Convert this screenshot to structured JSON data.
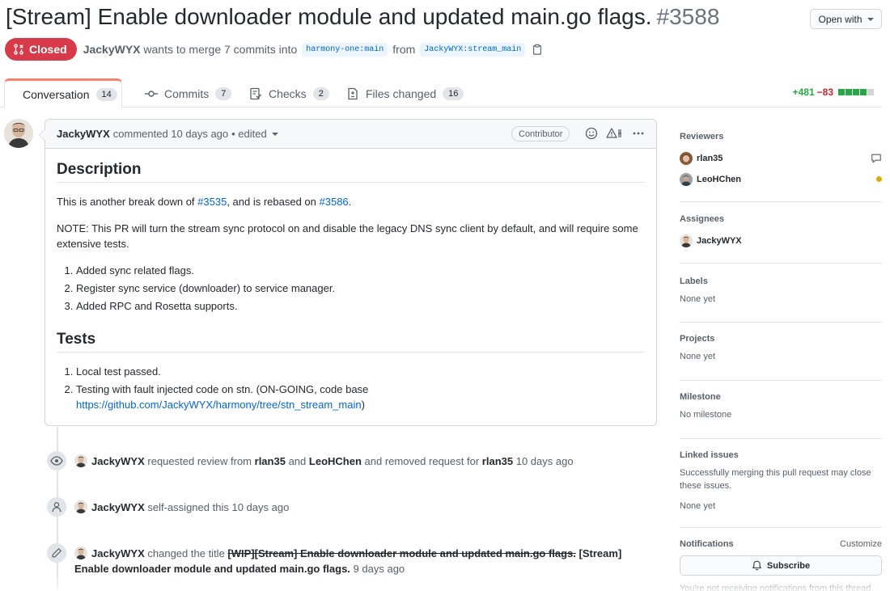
{
  "pr": {
    "title": "[Stream] Enable downloader module and updated main.go flags.",
    "number": "#3588",
    "open_with": "Open with",
    "state": "Closed",
    "author": "JackyWYX",
    "merge_text": "wants to merge 7 commits into",
    "base_branch": "harmony-one:main",
    "from_text": "from",
    "head_branch": "JackyWYX:stream_main"
  },
  "tabs": [
    {
      "label": "Conversation",
      "count": "14"
    },
    {
      "label": "Commits",
      "count": "7"
    },
    {
      "label": "Checks",
      "count": "2"
    },
    {
      "label": "Files changed",
      "count": "16"
    }
  ],
  "diffstat": {
    "additions": "+481",
    "deletions": "−83"
  },
  "comment": {
    "author": "JackyWYX",
    "action": "commented 10 days ago",
    "edited": "• edited",
    "role": "Contributor",
    "h_description": "Description",
    "p1_pre": "This is another break down of ",
    "p1_link1": "#3535",
    "p1_mid": ", and is rebased on ",
    "p1_link2": "#3586",
    "p1_post": ".",
    "p2": "NOTE: This PR will turn the stream sync protocol on and disable the legacy DNS sync client by default, and will require some extensive tests.",
    "list1": [
      "Added sync related flags.",
      "Register sync service (downloader) to service manager.",
      "Added RPC and Rosetta supports."
    ],
    "h_tests": "Tests",
    "t1": "Local test passed.",
    "t2_pre": "Testing with fault injected code on stn. (ON-GOING, code base",
    "t2_link": "https://github.com/JackyWYX/harmony/tree/stn_stream_main",
    "t2_post": ")"
  },
  "timeline": {
    "e1": {
      "actor": "JackyWYX",
      "t1": "requested review from",
      "u1": "rlan35",
      "t2": "and",
      "u2": "LeoHChen",
      "t3": "and removed request for",
      "u3": "rlan35",
      "time": "10 days ago"
    },
    "e2": {
      "actor": "JackyWYX",
      "text": "self-assigned this",
      "time": "10 days ago"
    },
    "e3": {
      "actor": "JackyWYX",
      "text": "changed the title",
      "old": "[WIP][Stream] Enable downloader module and updated main.go flags.",
      "new": "[Stream] Enable downloader module and updated main.go flags.",
      "time": "9 days ago"
    }
  },
  "sidebar": {
    "reviewers_title": "Reviewers",
    "reviewers": [
      "rlan35",
      "LeoHChen"
    ],
    "assignees_title": "Assignees",
    "assignee": "JackyWYX",
    "labels_title": "Labels",
    "labels_value": "None yet",
    "projects_title": "Projects",
    "projects_value": "None yet",
    "milestone_title": "Milestone",
    "milestone_value": "No milestone",
    "linked_title": "Linked issues",
    "linked_desc": "Successfully merging this pull request may close these issues.",
    "linked_value": "None yet",
    "notifications_title": "Notifications",
    "customize": "Customize",
    "subscribe": "Subscribe",
    "notif_text": "You're not receiving notifications from this thread."
  },
  "colors": {
    "closed": "#d73a49",
    "add": "#28a745",
    "del": "#cb2431",
    "link": "#0366d6",
    "tab_accent": "#f9826c"
  }
}
